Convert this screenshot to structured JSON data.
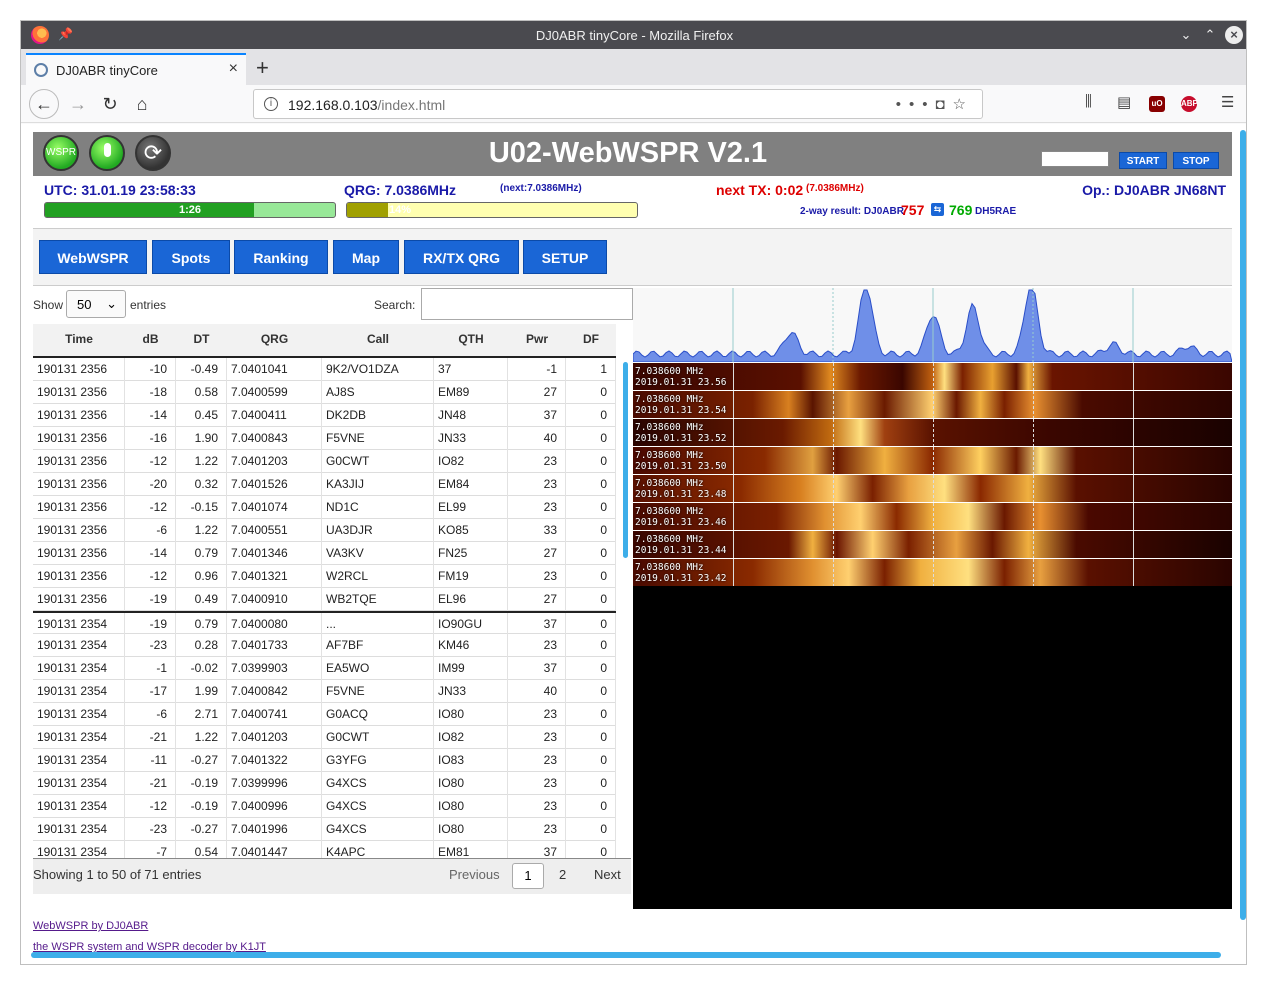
{
  "browser": {
    "window_title": "DJ0ABR tinyCore - Mozilla Firefox",
    "tab_title": "DJ0ABR tinyCore",
    "url_host": "192.168.0.103",
    "url_path": "/index.html",
    "menu_glyph": "☰"
  },
  "app": {
    "title": "U02-WebWSPR V2.1",
    "wspr_label": "WSPR",
    "start_label": "START",
    "stop_label": "STOP",
    "utc": "UTC: 31.01.19 23:58:33",
    "qrg": "QRG: 7.0386MHz",
    "next_qrg": "(next:7.0386MHz)",
    "next_tx": "next TX: 0:02",
    "next_tx_qrg": "(7.0386MHz)",
    "operator": "Op.: DJ0ABR JN68NT",
    "bar1_label": "1:26",
    "bar1_fraction": 0.72,
    "bar2_label": "14%",
    "bar2_fraction": 0.14,
    "twoway_label": "2-way result: DJ0ABR",
    "twoway_a": "757",
    "twoway_b": "769",
    "twoway_call": "DH5RAE"
  },
  "menu": [
    "WebWSPR",
    "Spots",
    "Ranking",
    "Map",
    "RX/TX QRG",
    "SETUP"
  ],
  "table": {
    "show_label": "Show",
    "length_value": "50",
    "entries_label": "entries",
    "search_label": "Search:",
    "headers": [
      "Time",
      "dB",
      "DT",
      "QRG",
      "Call",
      "QTH",
      "Pwr",
      "DF"
    ],
    "rows": [
      [
        "190131 2356",
        "-10",
        "-0.49",
        "7.0401041",
        "9K2/VO1DZA",
        "37",
        "-1",
        "1"
      ],
      [
        "190131 2356",
        "-18",
        "0.58",
        "7.0400599",
        "AJ8S",
        "EM89",
        "27",
        "0"
      ],
      [
        "190131 2356",
        "-14",
        "0.45",
        "7.0400411",
        "DK2DB",
        "JN48",
        "37",
        "0"
      ],
      [
        "190131 2356",
        "-16",
        "1.90",
        "7.0400843",
        "F5VNE",
        "JN33",
        "40",
        "0"
      ],
      [
        "190131 2356",
        "-12",
        "1.22",
        "7.0401203",
        "G0CWT",
        "IO82",
        "23",
        "0"
      ],
      [
        "190131 2356",
        "-20",
        "0.32",
        "7.0401526",
        "KA3JIJ",
        "EM84",
        "23",
        "0"
      ],
      [
        "190131 2356",
        "-12",
        "-0.15",
        "7.0401074",
        "ND1C",
        "EL99",
        "23",
        "0"
      ],
      [
        "190131 2356",
        "-6",
        "1.22",
        "7.0400551",
        "UA3DJR",
        "KO85",
        "33",
        "0"
      ],
      [
        "190131 2356",
        "-14",
        "0.79",
        "7.0401346",
        "VA3KV",
        "FN25",
        "27",
        "0"
      ],
      [
        "190131 2356",
        "-12",
        "0.96",
        "7.0401321",
        "W2RCL",
        "FM19",
        "23",
        "0"
      ],
      [
        "190131 2356",
        "-19",
        "0.49",
        "7.0400910",
        "WB2TQE",
        "EL96",
        "27",
        "0"
      ],
      [
        "190131 2354",
        "-19",
        "0.79",
        "7.0400080",
        "...",
        "IO90GU",
        "37",
        "0"
      ],
      [
        "190131 2354",
        "-23",
        "0.28",
        "7.0401733",
        "AF7BF",
        "KM46",
        "23",
        "0"
      ],
      [
        "190131 2354",
        "-1",
        "-0.02",
        "7.0399903",
        "EA5WO",
        "IM99",
        "37",
        "0"
      ],
      [
        "190131 2354",
        "-17",
        "1.99",
        "7.0400842",
        "F5VNE",
        "JN33",
        "40",
        "0"
      ],
      [
        "190131 2354",
        "-6",
        "2.71",
        "7.0400741",
        "G0ACQ",
        "IO80",
        "23",
        "0"
      ],
      [
        "190131 2354",
        "-21",
        "1.22",
        "7.0401203",
        "G0CWT",
        "IO82",
        "23",
        "0"
      ],
      [
        "190131 2354",
        "-11",
        "-0.27",
        "7.0401322",
        "G3YFG",
        "IO83",
        "23",
        "0"
      ],
      [
        "190131 2354",
        "-21",
        "-0.19",
        "7.0399996",
        "G4XCS",
        "IO80",
        "23",
        "0"
      ],
      [
        "190131 2354",
        "-12",
        "-0.19",
        "7.0400996",
        "G4XCS",
        "IO80",
        "23",
        "0"
      ],
      [
        "190131 2354",
        "-23",
        "-0.27",
        "7.0401996",
        "G4XCS",
        "IO80",
        "23",
        "0"
      ],
      [
        "190131 2354",
        "-7",
        "0.54",
        "7.0401447",
        "K4APC",
        "EM81",
        "37",
        "0"
      ]
    ],
    "info": "Showing 1 to 50 of 71 entries",
    "prev": "Previous",
    "page1": "1",
    "page2": "2",
    "next": "Next"
  },
  "links": [
    "WebWSPR by DJ0ABR",
    "the WSPR system and WSPR decoder by K1JT"
  ],
  "waterfall": {
    "freq": "7.038600 MHz",
    "times": [
      "2019.01.31 23.56",
      "2019.01.31 23.54",
      "2019.01.31 23.52",
      "2019.01.31 23.50",
      "2019.01.31 23.48",
      "2019.01.31 23.46",
      "2019.01.31 23.44",
      "2019.01.31 23.42"
    ]
  }
}
